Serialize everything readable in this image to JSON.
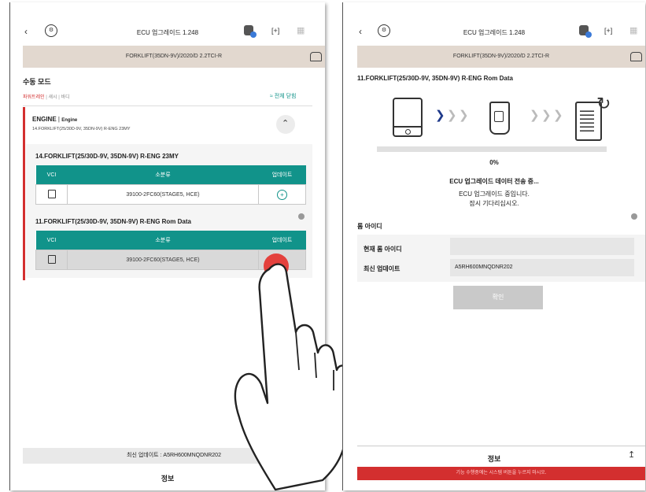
{
  "left": {
    "topbar": {
      "title": "ECU 업그레이드 1.248"
    },
    "vehicle": "FORKLIFT(35DN-9V)/2020/D 2.2TCI-R",
    "mode_title": "수동 모드",
    "filters": [
      "파워트레인",
      "섀시",
      "바디"
    ],
    "expand_all": "전체 닫힘",
    "system": {
      "name": "ENGINE",
      "sub": "Engine",
      "desc": "14.FORKLIFT(25/30D-9V, 35DN-9V) R-ENG 23MY"
    },
    "items": [
      {
        "title": "14.FORKLIFT(25/30D-9V, 35DN-9V) R-ENG 23MY",
        "headers": [
          "VCI",
          "소분류",
          "업데이트"
        ],
        "cell": "39100-2FC60(STAGE5, HCE)"
      },
      {
        "title": "11.FORKLIFT(25/30D-9V, 35DN-9V) R-ENG Rom Data",
        "headers": [
          "VCI",
          "소분류",
          "업데이트"
        ],
        "cell": "39100-2FC60(STAGE5, HCE)"
      }
    ],
    "footer_latest": "최신 업데이트 : A5RH600MNQDNR202",
    "footer_tab": "정보"
  },
  "right": {
    "topbar": {
      "title": "ECU 업그레이드 1.248"
    },
    "vehicle": "FORKLIFT(35DN-9V)/2020/D 2.2TCI-R",
    "rom_title": "11.FORKLIFT(25/30D-9V, 35DN-9V) R-ENG Rom Data",
    "progress": {
      "percent_text": "0%",
      "value": 0
    },
    "status_title": "ECU 업그레이드 데이터 전송 중...",
    "status_line1": "ECU 업그레이드 중입니다.",
    "status_line2": "잠시 기다리십시오.",
    "rom_section": "롬 아이디",
    "rows": [
      {
        "label": "현재 롬 아이디",
        "value": ""
      },
      {
        "label": "최신 업데이트",
        "value": "A5RH600MNQDNR202"
      }
    ],
    "confirm": "확인",
    "footer_tab": "정보",
    "warning": "기능 수행중에는 시스템 버튼을 누르지 마시오."
  },
  "colors": {
    "teal": "#11938a",
    "red": "#d32f2f",
    "accent": "#e53935"
  }
}
